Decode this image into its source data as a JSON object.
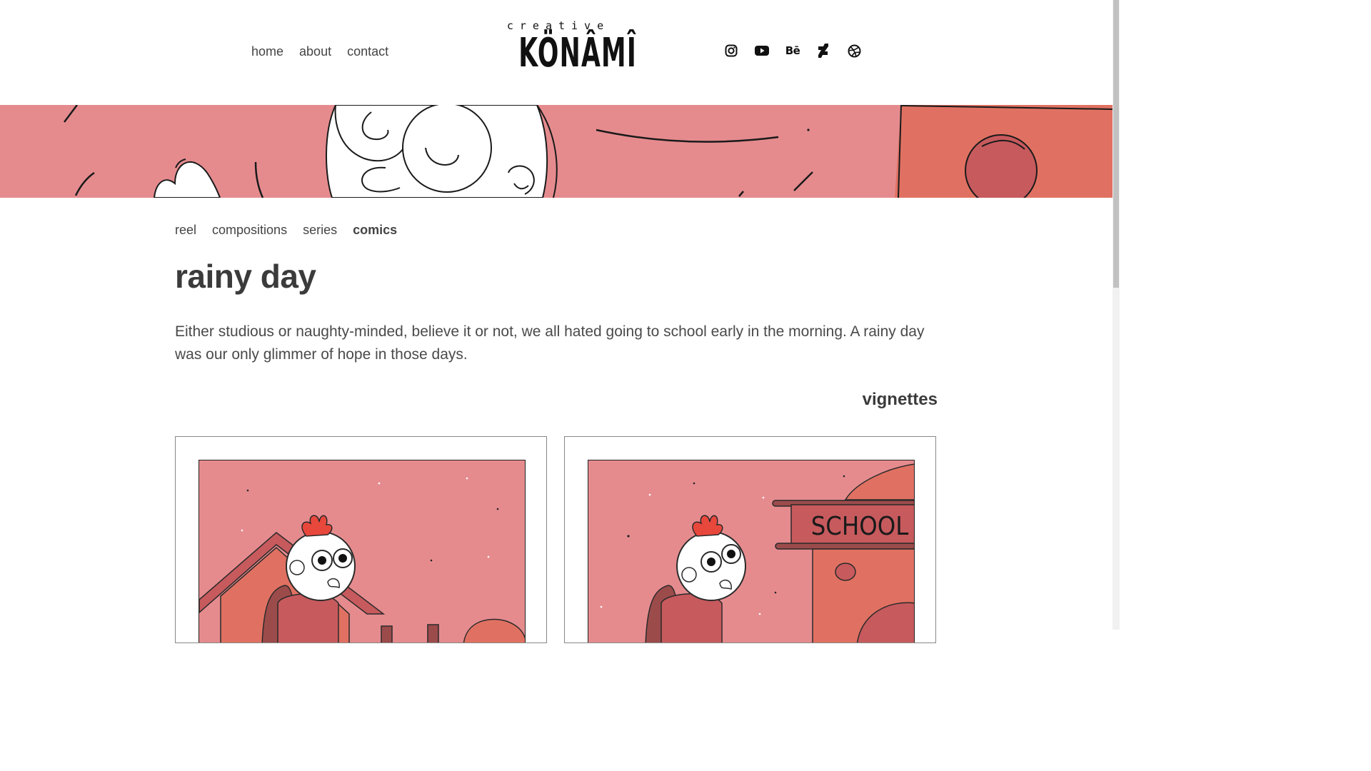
{
  "header": {
    "nav": [
      {
        "label": "home"
      },
      {
        "label": "about"
      },
      {
        "label": "contact"
      }
    ],
    "logo": {
      "line1": "creative",
      "line2": "KÖNÂMÎ"
    },
    "social": [
      {
        "icon": "instagram-icon"
      },
      {
        "icon": "youtube-icon"
      },
      {
        "icon": "behance-icon",
        "label": "Bē"
      },
      {
        "icon": "deviantart-icon"
      },
      {
        "icon": "dribbble-icon"
      }
    ]
  },
  "subnav": [
    {
      "label": "reel"
    },
    {
      "label": "compositions"
    },
    {
      "label": "series"
    },
    {
      "label": "comics",
      "active": true
    }
  ],
  "page": {
    "title": "rainy day",
    "description": "Either studious or naughty-minded, believe it or not, we all hated going to school early in the morning. A rainy day was our only glimmer of hope in those days.",
    "section_title": "vignettes"
  },
  "panels": [
    {
      "sign": ""
    },
    {
      "sign": "SCHOOL"
    }
  ],
  "colors": {
    "pink": "#e58b8e",
    "coral": "#e07162",
    "red": "#e8473c",
    "dark_red": "#c75a5d",
    "text": "#3e3e3e"
  }
}
